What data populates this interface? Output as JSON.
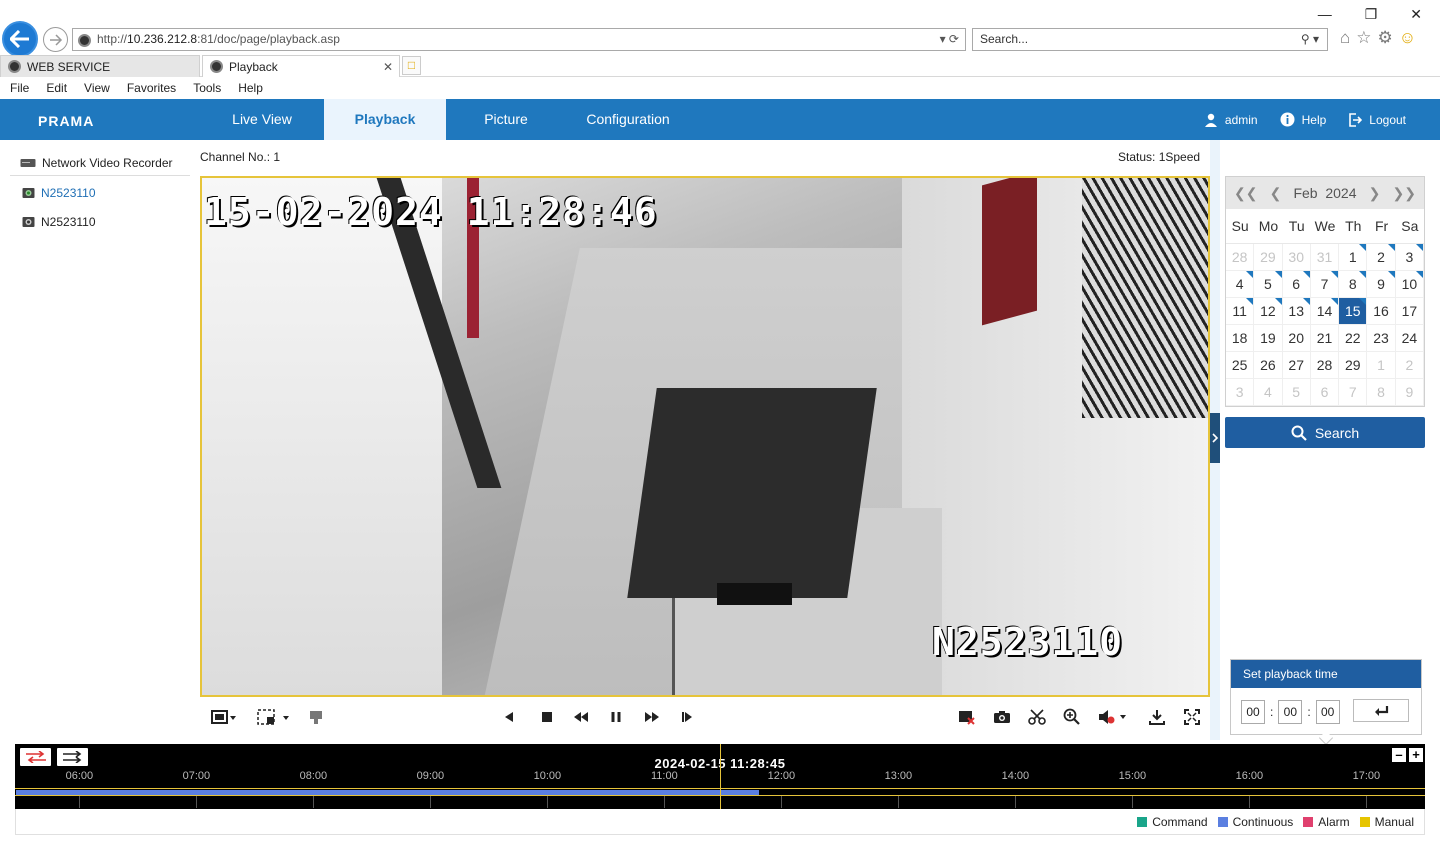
{
  "browser": {
    "url_prefix": "http://",
    "url_host": "10.236.212.8",
    "url_rest": ":81/doc/page/playback.asp",
    "search_placeholder": "Search...",
    "tabs": [
      {
        "label": "WEB SERVICE"
      },
      {
        "label": "Playback"
      }
    ],
    "menu": [
      "File",
      "Edit",
      "View",
      "Favorites",
      "Tools",
      "Help"
    ]
  },
  "nav": {
    "logo": "PRAMA",
    "tabs": [
      {
        "label": "Live View"
      },
      {
        "label": "Playback"
      },
      {
        "label": "Picture"
      },
      {
        "label": "Configuration"
      }
    ],
    "user": "admin",
    "help": "Help",
    "logout": "Logout"
  },
  "left": {
    "device": "Network Video Recorder",
    "cameras": [
      {
        "label": "N2523110"
      },
      {
        "label": "N2523110"
      }
    ]
  },
  "main": {
    "channel": "Channel No.: 1",
    "status": "Status: 1Speed",
    "osd_time": "15-02-2024 11:28:46",
    "osd_camera": "N2523110"
  },
  "calendar": {
    "month": "Feb",
    "year": "2024",
    "dow": [
      "Su",
      "Mo",
      "Tu",
      "We",
      "Th",
      "Fr",
      "Sa"
    ],
    "days": [
      {
        "d": "28",
        "m": true,
        "r": false
      },
      {
        "d": "29",
        "m": true,
        "r": false
      },
      {
        "d": "30",
        "m": true,
        "r": false
      },
      {
        "d": "31",
        "m": true,
        "r": false
      },
      {
        "d": "1",
        "m": false,
        "r": true
      },
      {
        "d": "2",
        "m": false,
        "r": true
      },
      {
        "d": "3",
        "m": false,
        "r": true
      },
      {
        "d": "4",
        "m": false,
        "r": true
      },
      {
        "d": "5",
        "m": false,
        "r": true
      },
      {
        "d": "6",
        "m": false,
        "r": true
      },
      {
        "d": "7",
        "m": false,
        "r": true
      },
      {
        "d": "8",
        "m": false,
        "r": true
      },
      {
        "d": "9",
        "m": false,
        "r": true
      },
      {
        "d": "10",
        "m": false,
        "r": true
      },
      {
        "d": "11",
        "m": false,
        "r": true
      },
      {
        "d": "12",
        "m": false,
        "r": true
      },
      {
        "d": "13",
        "m": false,
        "r": true
      },
      {
        "d": "14",
        "m": false,
        "r": true
      },
      {
        "d": "15",
        "m": false,
        "r": true,
        "s": true
      },
      {
        "d": "16",
        "m": false,
        "r": false
      },
      {
        "d": "17",
        "m": false,
        "r": false
      },
      {
        "d": "18",
        "m": false,
        "r": false
      },
      {
        "d": "19",
        "m": false,
        "r": false
      },
      {
        "d": "20",
        "m": false,
        "r": false
      },
      {
        "d": "21",
        "m": false,
        "r": false
      },
      {
        "d": "22",
        "m": false,
        "r": false
      },
      {
        "d": "23",
        "m": false,
        "r": false
      },
      {
        "d": "24",
        "m": false,
        "r": false
      },
      {
        "d": "25",
        "m": false,
        "r": false
      },
      {
        "d": "26",
        "m": false,
        "r": false
      },
      {
        "d": "27",
        "m": false,
        "r": false
      },
      {
        "d": "28",
        "m": false,
        "r": false
      },
      {
        "d": "29",
        "m": false,
        "r": false
      },
      {
        "d": "1",
        "m": true,
        "r": false
      },
      {
        "d": "2",
        "m": true,
        "r": false
      },
      {
        "d": "3",
        "m": true,
        "r": false
      },
      {
        "d": "4",
        "m": true,
        "r": false
      },
      {
        "d": "5",
        "m": true,
        "r": false
      },
      {
        "d": "6",
        "m": true,
        "r": false
      },
      {
        "d": "7",
        "m": true,
        "r": false
      },
      {
        "d": "8",
        "m": true,
        "r": false
      },
      {
        "d": "9",
        "m": true,
        "r": false
      }
    ],
    "search_label": "Search"
  },
  "playback_time": {
    "title": "Set playback time",
    "hh": "00",
    "mm": "00",
    "ss": "00"
  },
  "timeline": {
    "current": "2024-02-15 11:28:45",
    "hours": [
      "06:00",
      "07:00",
      "08:00",
      "09:00",
      "10:00",
      "11:00",
      "12:00",
      "13:00",
      "14:00",
      "15:00",
      "16:00",
      "17:00"
    ],
    "recorded_until": "11:48",
    "cursor_time": "11:28:45"
  },
  "legend": [
    {
      "label": "Command",
      "color": "#1aa58a"
    },
    {
      "label": "Continuous",
      "color": "#5b7fe0"
    },
    {
      "label": "Alarm",
      "color": "#e0406e"
    },
    {
      "label": "Manual",
      "color": "#e6c400"
    }
  ],
  "colors": {
    "brand": "#1f78be",
    "accent_dark": "#1f5ea1",
    "timeline_border": "#e6c43a"
  }
}
